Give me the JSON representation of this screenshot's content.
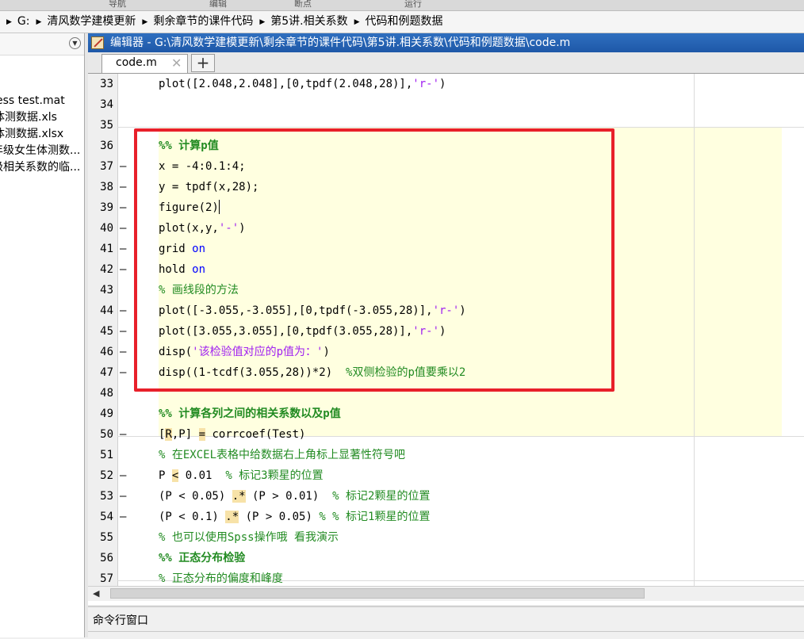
{
  "ribbon": {
    "labels": [
      "导航",
      "编辑",
      "断点",
      "运行"
    ]
  },
  "path": {
    "segments": [
      "G:",
      "清风数学建模更新",
      "剩余章节的课件代码",
      "第5讲.相关系数",
      "代码和例题数据"
    ]
  },
  "file_browser": {
    "files": [
      "ess test.mat",
      "体测数据.xls",
      "体测数据.xlsx",
      "年级女生体测数...",
      "级相关系数的临..."
    ]
  },
  "editor": {
    "title": "编辑器 - G:\\清风数学建模更新\\剩余章节的课件代码\\第5讲.相关系数\\代码和例题数据\\code.m",
    "tab_label": "code.m",
    "lines": [
      {
        "n": "33",
        "dash": "",
        "code": [
          "plot([2.048,2.048],[0,tpdf(2.048,28)],",
          "'r-'",
          ")"
        ]
      },
      {
        "n": "34",
        "dash": "",
        "code": [
          ""
        ]
      },
      {
        "n": "35",
        "dash": "",
        "code": [
          ""
        ]
      },
      {
        "n": "36",
        "dash": "",
        "code": [
          "%% 计算p值"
        ]
      },
      {
        "n": "37",
        "dash": "—",
        "code": [
          "x = -4:0.1:4;"
        ]
      },
      {
        "n": "38",
        "dash": "—",
        "code": [
          "y = tpdf(x,28);"
        ]
      },
      {
        "n": "39",
        "dash": "—",
        "code": [
          "figure(2)"
        ]
      },
      {
        "n": "40",
        "dash": "—",
        "code": [
          "plot(x,y,",
          "'-'",
          ")"
        ]
      },
      {
        "n": "41",
        "dash": "—",
        "code": [
          "grid ",
          "on"
        ]
      },
      {
        "n": "42",
        "dash": "—",
        "code": [
          "hold ",
          "on"
        ]
      },
      {
        "n": "43",
        "dash": "",
        "code": [
          "% 画线段的方法"
        ]
      },
      {
        "n": "44",
        "dash": "—",
        "code": [
          "plot([-3.055,-3.055],[0,tpdf(-3.055,28)],",
          "'r-'",
          ")"
        ]
      },
      {
        "n": "45",
        "dash": "—",
        "code": [
          "plot([3.055,3.055],[0,tpdf(3.055,28)],",
          "'r-'",
          ")"
        ]
      },
      {
        "n": "46",
        "dash": "—",
        "code": [
          "disp(",
          "'该检验值对应的p值为：'",
          ")"
        ]
      },
      {
        "n": "47",
        "dash": "—",
        "code": [
          "disp((1-tcdf(3.055,28))*2)  ",
          "%双侧检验的p值要乘以2"
        ]
      },
      {
        "n": "48",
        "dash": "",
        "code": [
          ""
        ]
      },
      {
        "n": "49",
        "dash": "",
        "code": [
          "%% 计算各列之间的相关系数以及p值"
        ]
      },
      {
        "n": "50",
        "dash": "—",
        "code": [
          "[",
          "R",
          ",P] ",
          "=",
          " corrcoef(Test)"
        ]
      },
      {
        "n": "51",
        "dash": "",
        "code": [
          "% 在EXCEL表格中给数据右上角标上显著性符号吧"
        ]
      },
      {
        "n": "52",
        "dash": "—",
        "code": [
          "P ",
          "<",
          " 0.01  ",
          "% 标记3颗星的位置"
        ]
      },
      {
        "n": "53",
        "dash": "—",
        "code": [
          "(P < 0.05) ",
          ".*",
          " (P > 0.01)  ",
          "% 标记2颗星的位置"
        ]
      },
      {
        "n": "54",
        "dash": "—",
        "code": [
          "(P < 0.1) ",
          ".*",
          " (P > 0.05) ",
          "% % 标记1颗星的位置"
        ]
      },
      {
        "n": "55",
        "dash": "",
        "code": [
          "% 也可以使用Spss操作哦 看我演示"
        ]
      },
      {
        "n": "56",
        "dash": "",
        "code": [
          "%% 正态分布检验"
        ]
      },
      {
        "n": "57",
        "dash": "",
        "code": [
          "% 正态分布的偏度和峰度"
        ]
      }
    ]
  },
  "command_window": {
    "title": "命令行窗口"
  },
  "icons": {
    "editor": "editor-icon",
    "close": "close-icon",
    "add": "add-tab-icon",
    "dropdown": "dropdown-icon",
    "chevron": "chevron-right-icon",
    "scroll_left": "scroll-left-icon"
  },
  "colors": {
    "string": "#a020f0",
    "keyword": "#0000ff",
    "comment": "#228b22",
    "highlight_cell": "#ffffe0",
    "annotation_box": "#e8202a",
    "title_bar": "#1e58a8"
  }
}
